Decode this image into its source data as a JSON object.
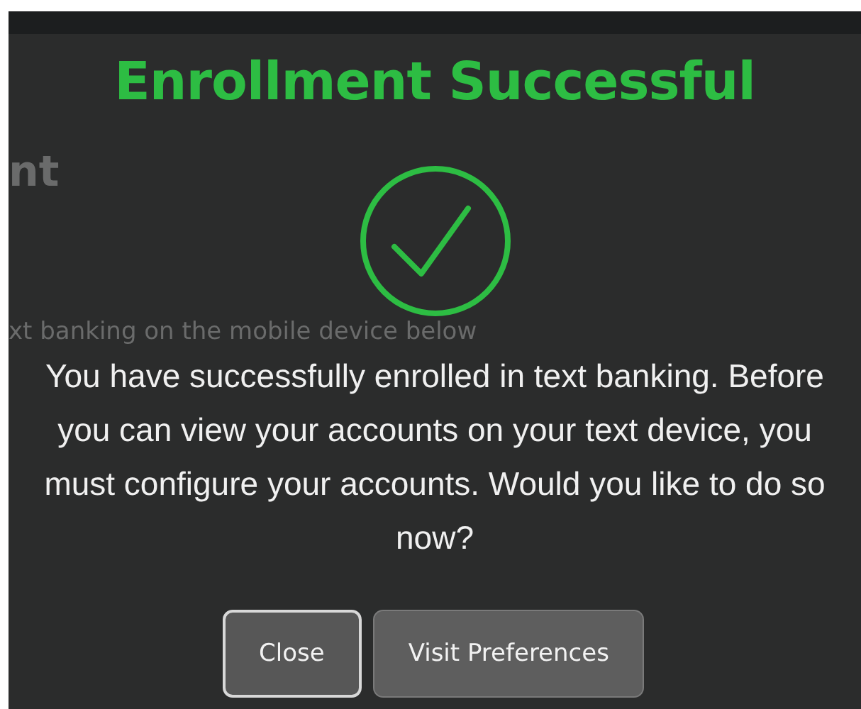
{
  "background_page": {
    "heading": "nt",
    "text": "xt banking on the mobile device below"
  },
  "dialog": {
    "title": "Enrollment Successful",
    "message": "You have successfully enrolled in text banking. Before you can view your accounts on your text device, you must configure your accounts. Would you like to do so now?",
    "buttons": [
      {
        "label": "Close",
        "focused": true
      },
      {
        "label": "Visit Preferences",
        "focused": false
      }
    ]
  }
}
